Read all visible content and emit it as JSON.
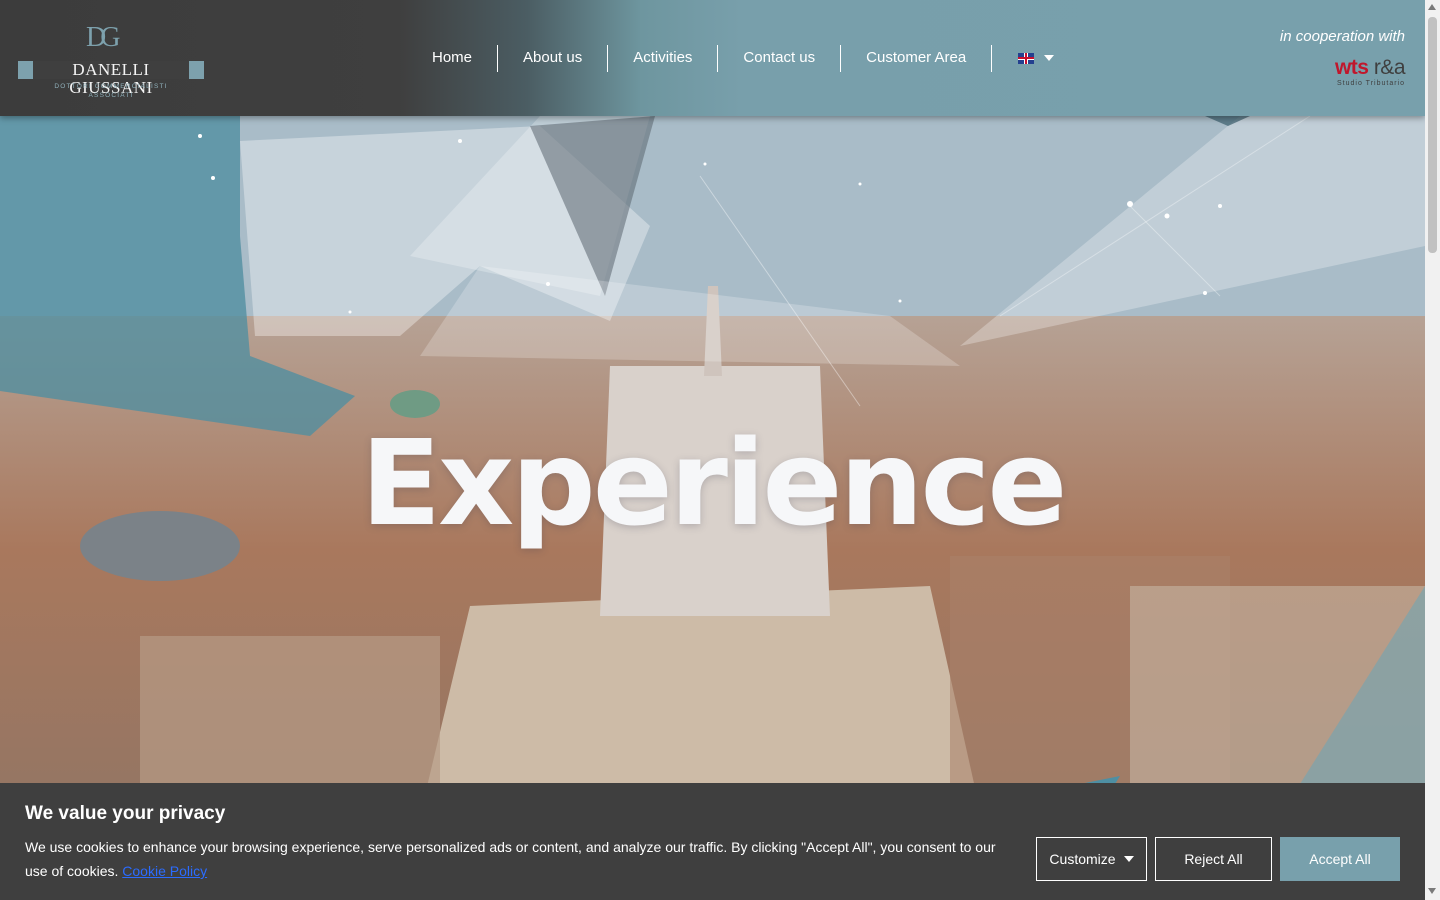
{
  "logo": {
    "monogram": "DG",
    "name": "DANELLI GIUSSANI",
    "tagline": "DOTTORI COMMERCIALISTI ASSOCIATI"
  },
  "nav": {
    "items": [
      {
        "label": "Home"
      },
      {
        "label": "About us"
      },
      {
        "label": "Activities"
      },
      {
        "label": "Contact us"
      },
      {
        "label": "Customer Area"
      }
    ],
    "language": {
      "flag_icon": "uk-flag-icon",
      "dropdown_icon": "caret-down-icon"
    }
  },
  "partner": {
    "cooperation_text": "in cooperation with",
    "brand_red": "wts",
    "brand_dark": "r&a",
    "subtitle": "Studio Tributario"
  },
  "hero": {
    "headline": "Experience"
  },
  "cookie_banner": {
    "title": "We value your privacy",
    "text": "We use cookies to enhance your browsing experience, serve personalized ads or content, and analyze our traffic. By clicking \"Accept All\", you consent to our use of cookies.",
    "link_label": "Cookie Policy",
    "customize_label": "Customize",
    "reject_label": "Reject All",
    "accept_label": "Accept All"
  },
  "colors": {
    "accent": "#78a0ac",
    "header_dark": "#3f3f3f",
    "banner_bg": "#3f3f3f",
    "brand_red": "#c0172c",
    "link": "#2b6cff"
  }
}
